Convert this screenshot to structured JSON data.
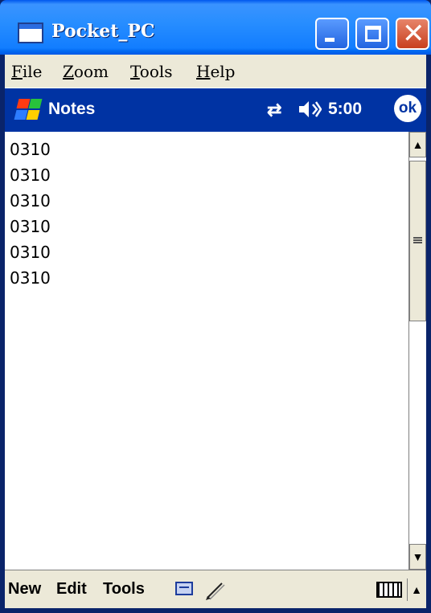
{
  "window": {
    "title": "Pocket_PC",
    "minimize_label": "",
    "maximize_label": "",
    "close_label": "✕"
  },
  "menu": {
    "items": [
      {
        "first": "F",
        "rest": "ile"
      },
      {
        "first": "Z",
        "rest": "oom"
      },
      {
        "first": "T",
        "rest": "ools"
      },
      {
        "first": "H",
        "rest": "elp"
      }
    ]
  },
  "navbar": {
    "title": "Notes",
    "connectivity_icon": "⇄",
    "speaker_icon": "◀",
    "clock": "5:00",
    "ok_label": "ok"
  },
  "notes": {
    "lines": [
      "0310",
      "0310",
      "0310",
      "0310",
      "0310",
      "0310"
    ]
  },
  "scrollbar": {
    "up": "▲",
    "down": "▼"
  },
  "command_bar": {
    "new_label": "New",
    "edit_label": "Edit",
    "tools_label": "Tools",
    "input_arrow": "▲"
  },
  "colors": {
    "titlebar": "#0058ee",
    "navbar": "#0033a3",
    "close_button": "#c8401f"
  }
}
